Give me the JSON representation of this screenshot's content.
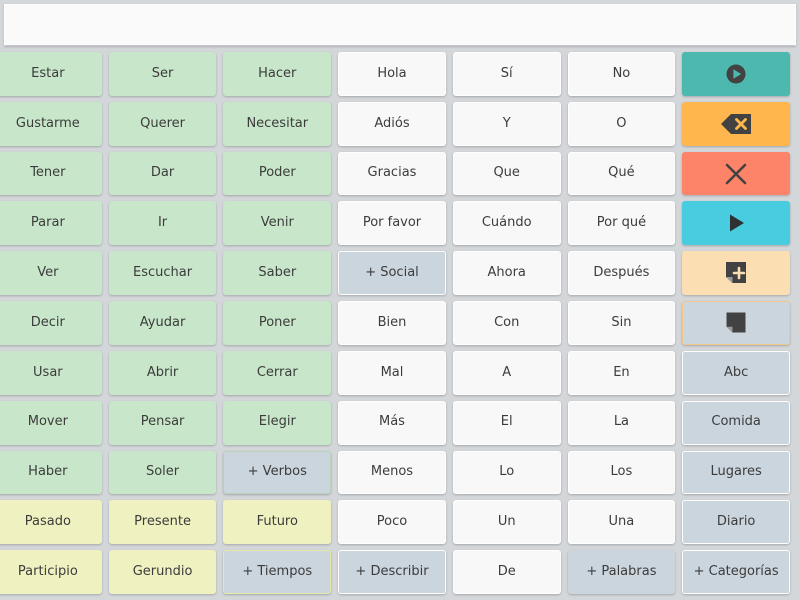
{
  "app": {
    "title": "AAC Communication Board",
    "language": "Spanish"
  },
  "message_bar": {
    "value": "",
    "placeholder": ""
  },
  "colors": {
    "background": "#d4d7da",
    "verb": "#c8e6c9",
    "tense": "#eff2c0",
    "core": "#f8f8f9",
    "navigation": "#cbd5dd",
    "speak": "#4cb8ae",
    "delete": "#ffb74d",
    "clear": "#fd8468",
    "play": "#47cce0",
    "add_note": "#fbdfb3",
    "note": "#cbd5dd",
    "text": "#3c3c3c"
  },
  "grid": {
    "columns": 7,
    "rows": 11,
    "cells": [
      {
        "label": "Estar",
        "type": "verb",
        "icon": null
      },
      {
        "label": "Ser",
        "type": "verb",
        "icon": null
      },
      {
        "label": "Hacer",
        "type": "verb",
        "icon": null
      },
      {
        "label": "Hola",
        "type": "core",
        "icon": null
      },
      {
        "label": "Sí",
        "type": "core",
        "icon": null
      },
      {
        "label": "No",
        "type": "core",
        "icon": null
      },
      {
        "label": "",
        "type": "speak",
        "icon": "speak-icon"
      },
      {
        "label": "Gustarme",
        "type": "verb",
        "icon": null
      },
      {
        "label": "Querer",
        "type": "verb",
        "icon": null
      },
      {
        "label": "Necesitar",
        "type": "verb",
        "icon": null
      },
      {
        "label": "Adiós",
        "type": "core",
        "icon": null
      },
      {
        "label": "Y",
        "type": "core",
        "icon": null
      },
      {
        "label": "O",
        "type": "core",
        "icon": null
      },
      {
        "label": "",
        "type": "delete",
        "icon": "backspace-icon"
      },
      {
        "label": "Tener",
        "type": "verb",
        "icon": null
      },
      {
        "label": "Dar",
        "type": "verb",
        "icon": null
      },
      {
        "label": "Poder",
        "type": "verb",
        "icon": null
      },
      {
        "label": "Gracias",
        "type": "core",
        "icon": null
      },
      {
        "label": "Que",
        "type": "core",
        "icon": null
      },
      {
        "label": "Qué",
        "type": "core",
        "icon": null
      },
      {
        "label": "",
        "type": "clear",
        "icon": "close-icon"
      },
      {
        "label": "Parar",
        "type": "verb",
        "icon": null
      },
      {
        "label": "Ir",
        "type": "verb",
        "icon": null
      },
      {
        "label": "Venir",
        "type": "verb",
        "icon": null
      },
      {
        "label": "Por favor",
        "type": "core",
        "icon": null
      },
      {
        "label": "Cuándo",
        "type": "core",
        "icon": null
      },
      {
        "label": "Por qué",
        "type": "core",
        "icon": null
      },
      {
        "label": "",
        "type": "play",
        "icon": "play-icon"
      },
      {
        "label": "Ver",
        "type": "verb",
        "icon": null
      },
      {
        "label": "Escuchar",
        "type": "verb",
        "icon": null
      },
      {
        "label": "Saber",
        "type": "verb",
        "icon": null
      },
      {
        "label": "+ Social",
        "type": "nav",
        "icon": null
      },
      {
        "label": "Ahora",
        "type": "core",
        "icon": null
      },
      {
        "label": "Después",
        "type": "core",
        "icon": null
      },
      {
        "label": "",
        "type": "add-note",
        "icon": "add-note-icon"
      },
      {
        "label": "Decir",
        "type": "verb",
        "icon": null
      },
      {
        "label": "Ayudar",
        "type": "verb",
        "icon": null
      },
      {
        "label": "Poner",
        "type": "verb",
        "icon": null
      },
      {
        "label": "Bien",
        "type": "core",
        "icon": null
      },
      {
        "label": "Con",
        "type": "core",
        "icon": null
      },
      {
        "label": "Sin",
        "type": "core",
        "icon": null
      },
      {
        "label": "",
        "type": "note",
        "icon": "note-icon"
      },
      {
        "label": "Usar",
        "type": "verb",
        "icon": null
      },
      {
        "label": "Abrir",
        "type": "verb",
        "icon": null
      },
      {
        "label": "Cerrar",
        "type": "verb",
        "icon": null
      },
      {
        "label": "Mal",
        "type": "core",
        "icon": null
      },
      {
        "label": "A",
        "type": "core",
        "icon": null
      },
      {
        "label": "En",
        "type": "core",
        "icon": null
      },
      {
        "label": "Abc",
        "type": "nav",
        "icon": null
      },
      {
        "label": "Mover",
        "type": "verb",
        "icon": null
      },
      {
        "label": "Pensar",
        "type": "verb",
        "icon": null
      },
      {
        "label": "Elegir",
        "type": "verb",
        "icon": null
      },
      {
        "label": "Más",
        "type": "core",
        "icon": null
      },
      {
        "label": "El",
        "type": "core",
        "icon": null
      },
      {
        "label": "La",
        "type": "core",
        "icon": null
      },
      {
        "label": "Comida",
        "type": "nav",
        "icon": null
      },
      {
        "label": "Haber",
        "type": "verb",
        "icon": null
      },
      {
        "label": "Soler",
        "type": "verb",
        "icon": null
      },
      {
        "label": "+ Verbos",
        "type": "nav-green",
        "icon": null
      },
      {
        "label": "Menos",
        "type": "core",
        "icon": null
      },
      {
        "label": "Lo",
        "type": "core",
        "icon": null
      },
      {
        "label": "Los",
        "type": "core",
        "icon": null
      },
      {
        "label": "Lugares",
        "type": "nav",
        "icon": null
      },
      {
        "label": "Pasado",
        "type": "tense",
        "icon": null
      },
      {
        "label": "Presente",
        "type": "tense",
        "icon": null
      },
      {
        "label": "Futuro",
        "type": "tense",
        "icon": null
      },
      {
        "label": "Poco",
        "type": "core",
        "icon": null
      },
      {
        "label": "Un",
        "type": "core",
        "icon": null
      },
      {
        "label": "Una",
        "type": "core",
        "icon": null
      },
      {
        "label": "Diario",
        "type": "nav",
        "icon": null
      },
      {
        "label": "Participio",
        "type": "tense",
        "icon": null
      },
      {
        "label": "Gerundio",
        "type": "tense",
        "icon": null
      },
      {
        "label": "+ Tiempos",
        "type": "nav-yellow",
        "icon": null
      },
      {
        "label": "+ Describir",
        "type": "nav",
        "icon": null
      },
      {
        "label": "De",
        "type": "core",
        "icon": null
      },
      {
        "label": "+ Palabras",
        "type": "nav-plain",
        "icon": null
      },
      {
        "label": "+ Categorías",
        "type": "nav",
        "icon": null
      }
    ]
  }
}
